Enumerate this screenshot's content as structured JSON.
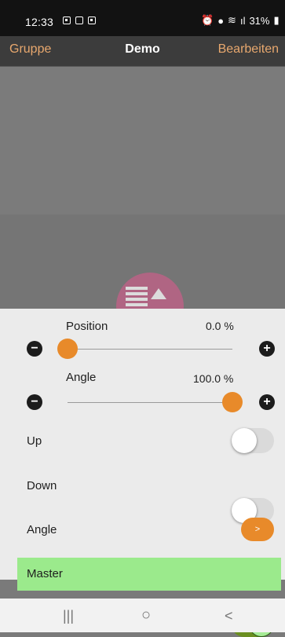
{
  "status_bar": {
    "time": "12:33",
    "left_icons": [
      "gallery-icon",
      "screen-icon",
      "notification-icon"
    ],
    "right_icons": [
      "alarm-icon",
      "location-icon",
      "wifi-icon",
      "signal-icon"
    ],
    "battery": "31%"
  },
  "navbar": {
    "left_label": "Gruppe",
    "title": "Demo",
    "right_label": "Bearbeiten"
  },
  "controls": {
    "position": {
      "label": "Position",
      "value_text": "0.0 %",
      "level": 0.0
    },
    "angle_slider": {
      "label": "Angle",
      "value_text": "100.0 %",
      "level": 1.0
    },
    "up_label": "Up",
    "up_on": false,
    "down_label": "Down",
    "down_on": false,
    "angle_row_label": "Angle",
    "angle_button": ">",
    "master_label": "Master",
    "master_on": true
  },
  "colors": {
    "accent": "#e88a2a",
    "nav_link": "#e8a86e",
    "master_highlight": "#9bea8c",
    "toggle_on": "#6b8f21"
  },
  "system_nav": {
    "recents": "|||",
    "home": "○",
    "back": "<"
  }
}
